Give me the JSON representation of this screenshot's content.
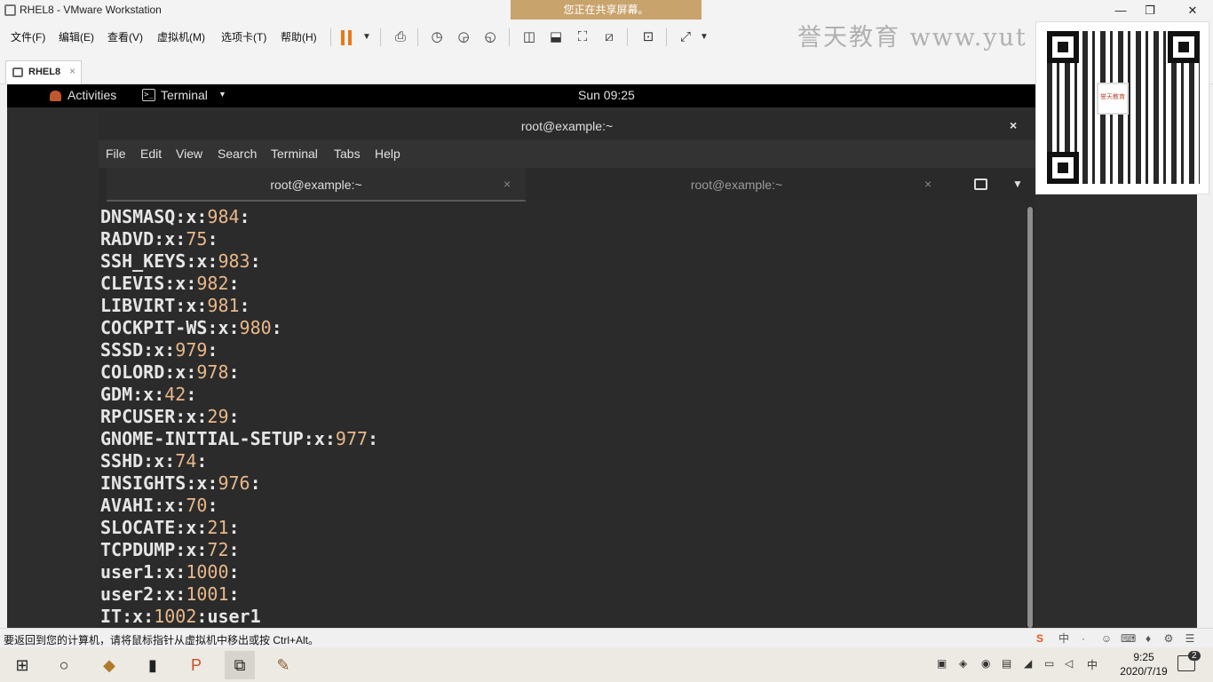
{
  "window": {
    "title": "RHEL8 - VMware Workstation",
    "share_banner": "您正在共享屏幕。",
    "controls": {
      "minimize": "—",
      "maximize": "❐",
      "close": "✕"
    }
  },
  "vm_menu": [
    "文件(F)",
    "编辑(E)",
    "查看(V)",
    "虚拟机(M)",
    "选项卡(T)",
    "帮助(H)"
  ],
  "watermark": "誉天教育 www.yut",
  "vm_tab": {
    "label": "RHEL8",
    "close": "×"
  },
  "guest": {
    "activities": "Activities",
    "app_menu": "Terminal",
    "clock": "Sun 09:25",
    "terminal": {
      "title": "root@example:~",
      "close": "×",
      "menu": [
        "File",
        "Edit",
        "View",
        "Search",
        "Terminal",
        "Tabs",
        "Help"
      ],
      "tabs": [
        {
          "label": "root@example:~",
          "close": "×"
        },
        {
          "label": "root@example:~",
          "close": "×"
        }
      ],
      "lines": [
        {
          "name": "DNSMASQ",
          "gid": "984",
          "extra": ""
        },
        {
          "name": "RADVD",
          "gid": "75",
          "extra": ""
        },
        {
          "name": "SSH_KEYS",
          "gid": "983",
          "extra": ""
        },
        {
          "name": "CLEVIS",
          "gid": "982",
          "extra": ""
        },
        {
          "name": "LIBVIRT",
          "gid": "981",
          "extra": ""
        },
        {
          "name": "COCKPIT-WS",
          "gid": "980",
          "extra": ""
        },
        {
          "name": "SSSD",
          "gid": "979",
          "extra": ""
        },
        {
          "name": "COLORD",
          "gid": "978",
          "extra": ""
        },
        {
          "name": "GDM",
          "gid": "42",
          "extra": ""
        },
        {
          "name": "RPCUSER",
          "gid": "29",
          "extra": ""
        },
        {
          "name": "GNOME-INITIAL-SETUP",
          "gid": "977",
          "extra": ""
        },
        {
          "name": "SSHD",
          "gid": "74",
          "extra": ""
        },
        {
          "name": "INSIGHTS",
          "gid": "976",
          "extra": ""
        },
        {
          "name": "AVAHI",
          "gid": "70",
          "extra": ""
        },
        {
          "name": "SLOCATE",
          "gid": "21",
          "extra": ""
        },
        {
          "name": "TCPDUMP",
          "gid": "72",
          "extra": ""
        },
        {
          "name": "user1",
          "gid": "1000",
          "extra": ""
        },
        {
          "name": "user2",
          "gid": "1001",
          "extra": ""
        },
        {
          "name": "IT",
          "gid": "1002",
          "extra": "user1"
        }
      ]
    }
  },
  "qr_logo_text": "誉天教育",
  "status_hint": "要返回到您的计算机，请将鼠标指针从虚拟机中移出或按 Ctrl+Alt。",
  "status_icons": [
    "S",
    "中",
    "·",
    "☺",
    "⌨",
    "♦",
    "⚙",
    "☰"
  ],
  "taskbar": {
    "time": "9:25",
    "date": "2020/7/19",
    "ime": "中",
    "notifications": "2"
  }
}
